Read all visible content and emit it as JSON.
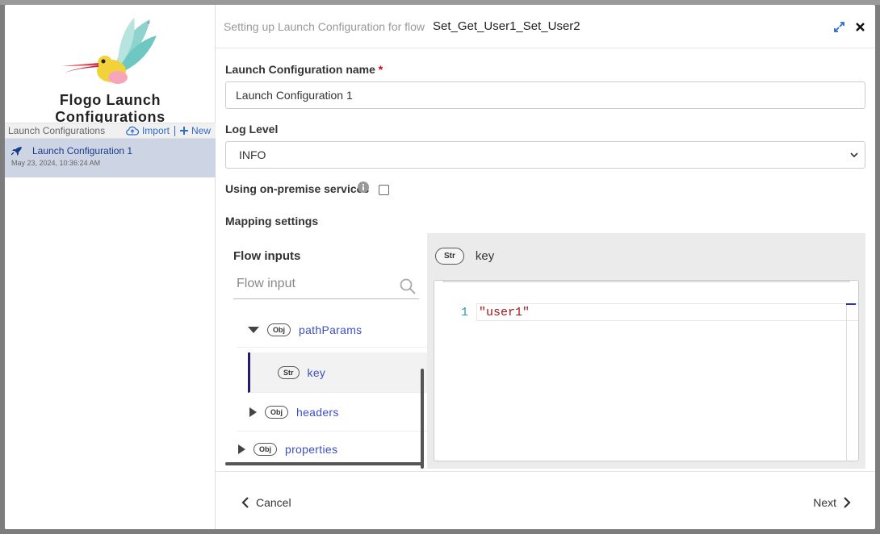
{
  "app": {
    "title": "Flogo Launch Configurations"
  },
  "sidebar": {
    "header_label": "Launch Configurations",
    "import_label": "Import",
    "new_label": "New",
    "items": [
      {
        "name": "Launch Configuration 1",
        "date": "May 23, 2024, 10:36:24 AM"
      }
    ]
  },
  "header": {
    "prefix": "Setting up Launch Configuration for flow",
    "flow_name": "Set_Get_User1_Set_User2"
  },
  "form": {
    "name_label": "Launch Configuration name",
    "name_required_mark": "*",
    "name_value": "Launch Configuration 1",
    "log_level_label": "Log Level",
    "log_level_value": "INFO",
    "on_premise_label": "Using on-premise services",
    "on_premise_checked": false,
    "mapping_label": "Mapping settings"
  },
  "flow_inputs": {
    "title": "Flow inputs",
    "search_placeholder": "Flow input",
    "tree": [
      {
        "type": "Obj",
        "label": "pathParams",
        "expanded": true
      },
      {
        "type": "Str",
        "label": "key",
        "selected": true
      },
      {
        "type": "Obj",
        "label": "headers",
        "expanded": false
      },
      {
        "type": "Obj",
        "label": "properties",
        "expanded": false
      }
    ]
  },
  "editor": {
    "type": "Str",
    "key": "key",
    "line_number": "1",
    "code": "\"user1\""
  },
  "footer": {
    "cancel_label": "Cancel",
    "next_label": "Next"
  },
  "colors": {
    "accent": "#3b4fc2",
    "selected_bg": "#cdd4e3",
    "required": "#d0021b"
  }
}
